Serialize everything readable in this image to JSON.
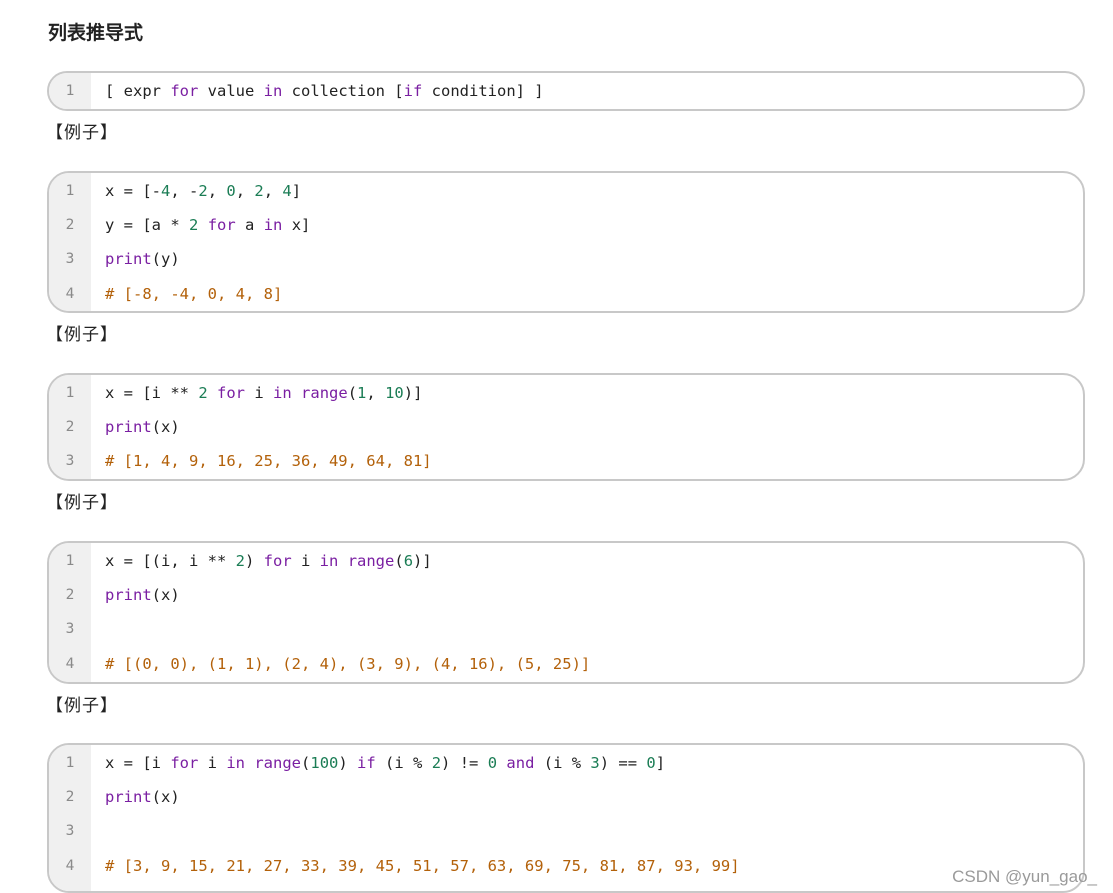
{
  "heading": "列表推导式",
  "example_label": "【例子】",
  "watermark": "CSDN @yun_gao_",
  "blocks": [
    {
      "lines": [
        {
          "n": "1",
          "tokens": [
            {
              "t": "[ expr ",
              "c": ""
            },
            {
              "t": "for",
              "c": "kw"
            },
            {
              "t": " value ",
              "c": ""
            },
            {
              "t": "in",
              "c": "kw"
            },
            {
              "t": " collection [",
              "c": ""
            },
            {
              "t": "if",
              "c": "kw"
            },
            {
              "t": " condition] ]",
              "c": ""
            }
          ]
        }
      ]
    },
    {
      "lines": [
        {
          "n": "1",
          "tokens": [
            {
              "t": "x = [-",
              "c": ""
            },
            {
              "t": "4",
              "c": "num"
            },
            {
              "t": ", -",
              "c": ""
            },
            {
              "t": "2",
              "c": "num"
            },
            {
              "t": ", ",
              "c": ""
            },
            {
              "t": "0",
              "c": "num"
            },
            {
              "t": ", ",
              "c": ""
            },
            {
              "t": "2",
              "c": "num"
            },
            {
              "t": ", ",
              "c": ""
            },
            {
              "t": "4",
              "c": "num"
            },
            {
              "t": "]",
              "c": ""
            }
          ]
        },
        {
          "n": "2",
          "tokens": [
            {
              "t": "y = [a * ",
              "c": ""
            },
            {
              "t": "2",
              "c": "num"
            },
            {
              "t": " ",
              "c": ""
            },
            {
              "t": "for",
              "c": "kw"
            },
            {
              "t": " a ",
              "c": ""
            },
            {
              "t": "in",
              "c": "kw"
            },
            {
              "t": " x]",
              "c": ""
            }
          ]
        },
        {
          "n": "3",
          "tokens": [
            {
              "t": "print",
              "c": "kw"
            },
            {
              "t": "(y)",
              "c": ""
            }
          ]
        },
        {
          "n": "4",
          "tokens": [
            {
              "t": "# [-8, -4, 0, 4, 8]",
              "c": "cmt"
            }
          ]
        }
      ]
    },
    {
      "lines": [
        {
          "n": "1",
          "tokens": [
            {
              "t": "x = [i ** ",
              "c": ""
            },
            {
              "t": "2",
              "c": "num"
            },
            {
              "t": " ",
              "c": ""
            },
            {
              "t": "for",
              "c": "kw"
            },
            {
              "t": " i ",
              "c": ""
            },
            {
              "t": "in",
              "c": "kw"
            },
            {
              "t": " ",
              "c": ""
            },
            {
              "t": "range",
              "c": "kw"
            },
            {
              "t": "(",
              "c": ""
            },
            {
              "t": "1",
              "c": "num"
            },
            {
              "t": ", ",
              "c": ""
            },
            {
              "t": "10",
              "c": "num"
            },
            {
              "t": ")]",
              "c": ""
            }
          ]
        },
        {
          "n": "2",
          "tokens": [
            {
              "t": "print",
              "c": "kw"
            },
            {
              "t": "(x)",
              "c": ""
            }
          ]
        },
        {
          "n": "3",
          "tokens": [
            {
              "t": "# [1, 4, 9, 16, 25, 36, 49, 64, 81]",
              "c": "cmt"
            }
          ]
        }
      ]
    },
    {
      "lines": [
        {
          "n": "1",
          "tokens": [
            {
              "t": "x = [(i, i ** ",
              "c": ""
            },
            {
              "t": "2",
              "c": "num"
            },
            {
              "t": ") ",
              "c": ""
            },
            {
              "t": "for",
              "c": "kw"
            },
            {
              "t": " i ",
              "c": ""
            },
            {
              "t": "in",
              "c": "kw"
            },
            {
              "t": " ",
              "c": ""
            },
            {
              "t": "range",
              "c": "kw"
            },
            {
              "t": "(",
              "c": ""
            },
            {
              "t": "6",
              "c": "num"
            },
            {
              "t": ")]",
              "c": ""
            }
          ]
        },
        {
          "n": "2",
          "tokens": [
            {
              "t": "print",
              "c": "kw"
            },
            {
              "t": "(x)",
              "c": ""
            }
          ]
        },
        {
          "n": "3",
          "tokens": []
        },
        {
          "n": "4",
          "tokens": [
            {
              "t": "# [(0, 0), (1, 1), (2, 4), (3, 9), (4, 16), (5, 25)]",
              "c": "cmt"
            }
          ]
        }
      ]
    },
    {
      "lines": [
        {
          "n": "1",
          "tokens": [
            {
              "t": "x = [i ",
              "c": ""
            },
            {
              "t": "for",
              "c": "kw"
            },
            {
              "t": " i ",
              "c": ""
            },
            {
              "t": "in",
              "c": "kw"
            },
            {
              "t": " ",
              "c": ""
            },
            {
              "t": "range",
              "c": "kw"
            },
            {
              "t": "(",
              "c": ""
            },
            {
              "t": "100",
              "c": "num"
            },
            {
              "t": ") ",
              "c": ""
            },
            {
              "t": "if",
              "c": "kw"
            },
            {
              "t": " (i % ",
              "c": ""
            },
            {
              "t": "2",
              "c": "num"
            },
            {
              "t": ") != ",
              "c": ""
            },
            {
              "t": "0",
              "c": "num"
            },
            {
              "t": " ",
              "c": ""
            },
            {
              "t": "and",
              "c": "kw"
            },
            {
              "t": " (i % ",
              "c": ""
            },
            {
              "t": "3",
              "c": "num"
            },
            {
              "t": ") == ",
              "c": ""
            },
            {
              "t": "0",
              "c": "num"
            },
            {
              "t": "]",
              "c": ""
            }
          ]
        },
        {
          "n": "2",
          "tokens": [
            {
              "t": "print",
              "c": "kw"
            },
            {
              "t": "(x)",
              "c": ""
            }
          ]
        },
        {
          "n": "3",
          "tokens": []
        },
        {
          "n": "4",
          "tokens": [
            {
              "t": "# [3, 9, 15, 21, 27, 33, 39, 45, 51, 57, 63, 69, 75, 81, 87, 93, 99]",
              "c": "cmt"
            }
          ]
        }
      ]
    }
  ]
}
